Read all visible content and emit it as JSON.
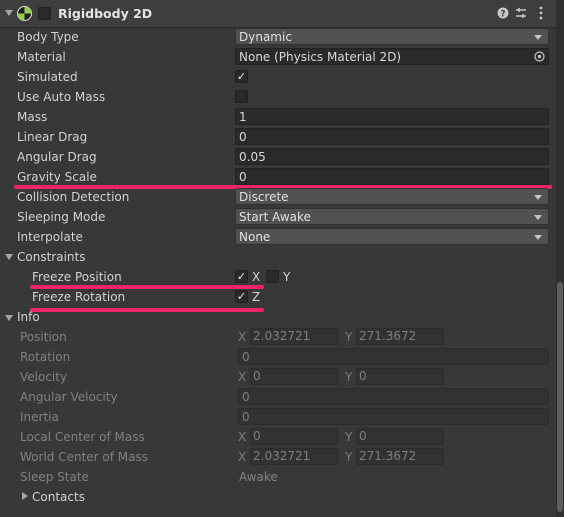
{
  "header": {
    "title": "Rigidbody 2D",
    "icons": {
      "toggle": "chevron-down-icon",
      "component": "rigidbody-icon",
      "help": "help-icon",
      "presets": "presets-icon",
      "menu": "kebab-menu-icon"
    }
  },
  "props": {
    "body_type": {
      "label": "Body Type",
      "value": "Dynamic"
    },
    "material": {
      "label": "Material",
      "value": "None (Physics Material 2D)"
    },
    "simulated": {
      "label": "Simulated",
      "check": "✓"
    },
    "use_auto_mass": {
      "label": "Use Auto Mass"
    },
    "mass": {
      "label": "Mass",
      "value": "1"
    },
    "linear_drag": {
      "label": "Linear Drag",
      "value": "0"
    },
    "angular_drag": {
      "label": "Angular Drag",
      "value": "0.05"
    },
    "gravity_scale": {
      "label": "Gravity Scale",
      "value": "0"
    },
    "collision_detection": {
      "label": "Collision Detection",
      "value": "Discrete"
    },
    "sleeping_mode": {
      "label": "Sleeping Mode",
      "value": "Start Awake"
    },
    "interpolate": {
      "label": "Interpolate",
      "value": "None"
    }
  },
  "constraints": {
    "label": "Constraints",
    "freeze_position": {
      "label": "Freeze Position",
      "x_label": "X",
      "y_label": "Y",
      "x_check": "✓"
    },
    "freeze_rotation": {
      "label": "Freeze Rotation",
      "z_label": "Z",
      "z_check": "✓"
    }
  },
  "info": {
    "label": "Info",
    "position": {
      "label": "Position",
      "x_label": "X",
      "x": "2.032721",
      "y_label": "Y",
      "y": "271.3672"
    },
    "rotation": {
      "label": "Rotation",
      "value": "0"
    },
    "velocity": {
      "label": "Velocity",
      "x_label": "X",
      "x": "0",
      "y_label": "Y",
      "y": "0"
    },
    "angular_velocity": {
      "label": "Angular Velocity",
      "value": "0"
    },
    "inertia": {
      "label": "Inertia",
      "value": "0"
    },
    "local_center_of_mass": {
      "label": "Local Center of Mass",
      "x_label": "X",
      "x": "0",
      "y_label": "Y",
      "y": "0"
    },
    "world_center_of_mass": {
      "label": "World Center of Mass",
      "x_label": "X",
      "x": "2.032721",
      "y_label": "Y",
      "y": "271.3672"
    },
    "sleep_state": {
      "label": "Sleep State",
      "value": "Awake"
    },
    "contacts": {
      "label": "Contacts"
    }
  },
  "colors": {
    "highlight": "#f0246a",
    "background": "#383838",
    "field": "#2a2a2a"
  }
}
